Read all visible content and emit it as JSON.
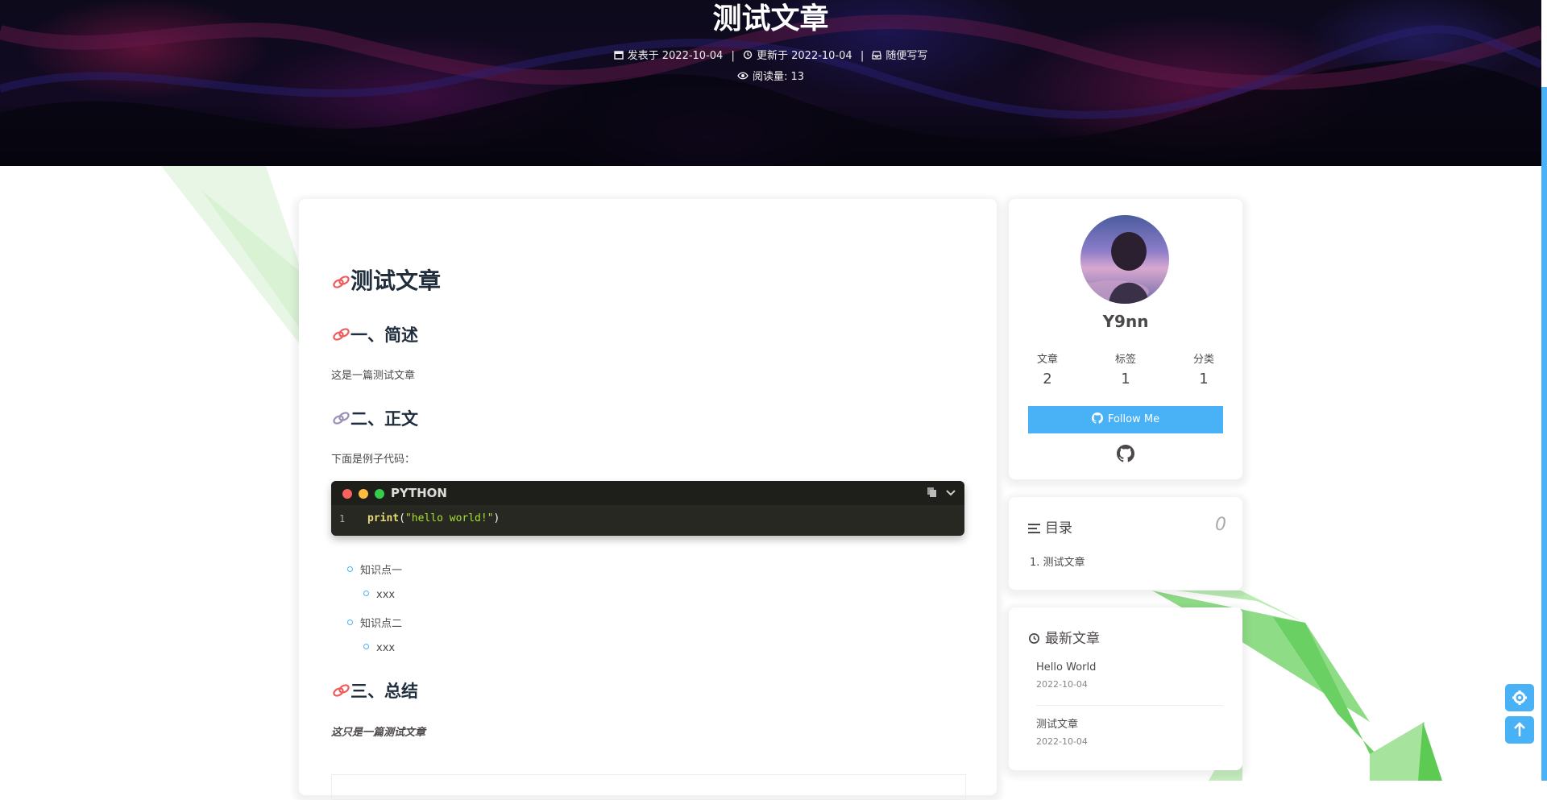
{
  "header": {
    "title": "测试文章",
    "published_label": "发表于",
    "published_date": "2022-10-04",
    "updated_label": "更新于",
    "updated_date": "2022-10-04",
    "category": "随便写写",
    "views_label": "阅读量:",
    "views_count": "13",
    "separator": "|"
  },
  "article": {
    "h1": "测试文章",
    "section1_title": "一、简述",
    "section1_text": "这是一篇测试文章",
    "section2_title": "二、正文",
    "section2_text": "下面是例子代码：",
    "code": {
      "language": "PYTHON",
      "line_number": "1",
      "fn": "print",
      "open": "(",
      "string": "\"hello world!\"",
      "close": ")"
    },
    "list": [
      {
        "label": "知识点一",
        "child": "xxx"
      },
      {
        "label": "知识点二",
        "child": "xxx"
      }
    ],
    "section3_title": "三、总结",
    "section3_text": "这只是一篇测试文章"
  },
  "sidebar": {
    "author": "Y9nn",
    "stats": [
      {
        "label": "文章",
        "value": "2"
      },
      {
        "label": "标签",
        "value": "1"
      },
      {
        "label": "分类",
        "value": "1"
      }
    ],
    "follow_label": "Follow Me",
    "toc_title": "目录",
    "toc_count": "0",
    "toc_items": [
      "1. 测试文章"
    ],
    "recent_title": "最新文章",
    "recent": [
      {
        "title": "Hello World",
        "date": "2022-10-04"
      },
      {
        "title": "测试文章",
        "date": "2022-10-04"
      }
    ]
  },
  "colors": {
    "accent": "#49b1f5",
    "code_bg": "#272822"
  },
  "icons": [
    "calendar-icon",
    "history-icon",
    "inbox-icon",
    "eye-icon",
    "link-icon",
    "github-icon",
    "list-icon",
    "gear-icon",
    "arrow-up-icon",
    "copy-icon",
    "chevron-down-icon"
  ]
}
